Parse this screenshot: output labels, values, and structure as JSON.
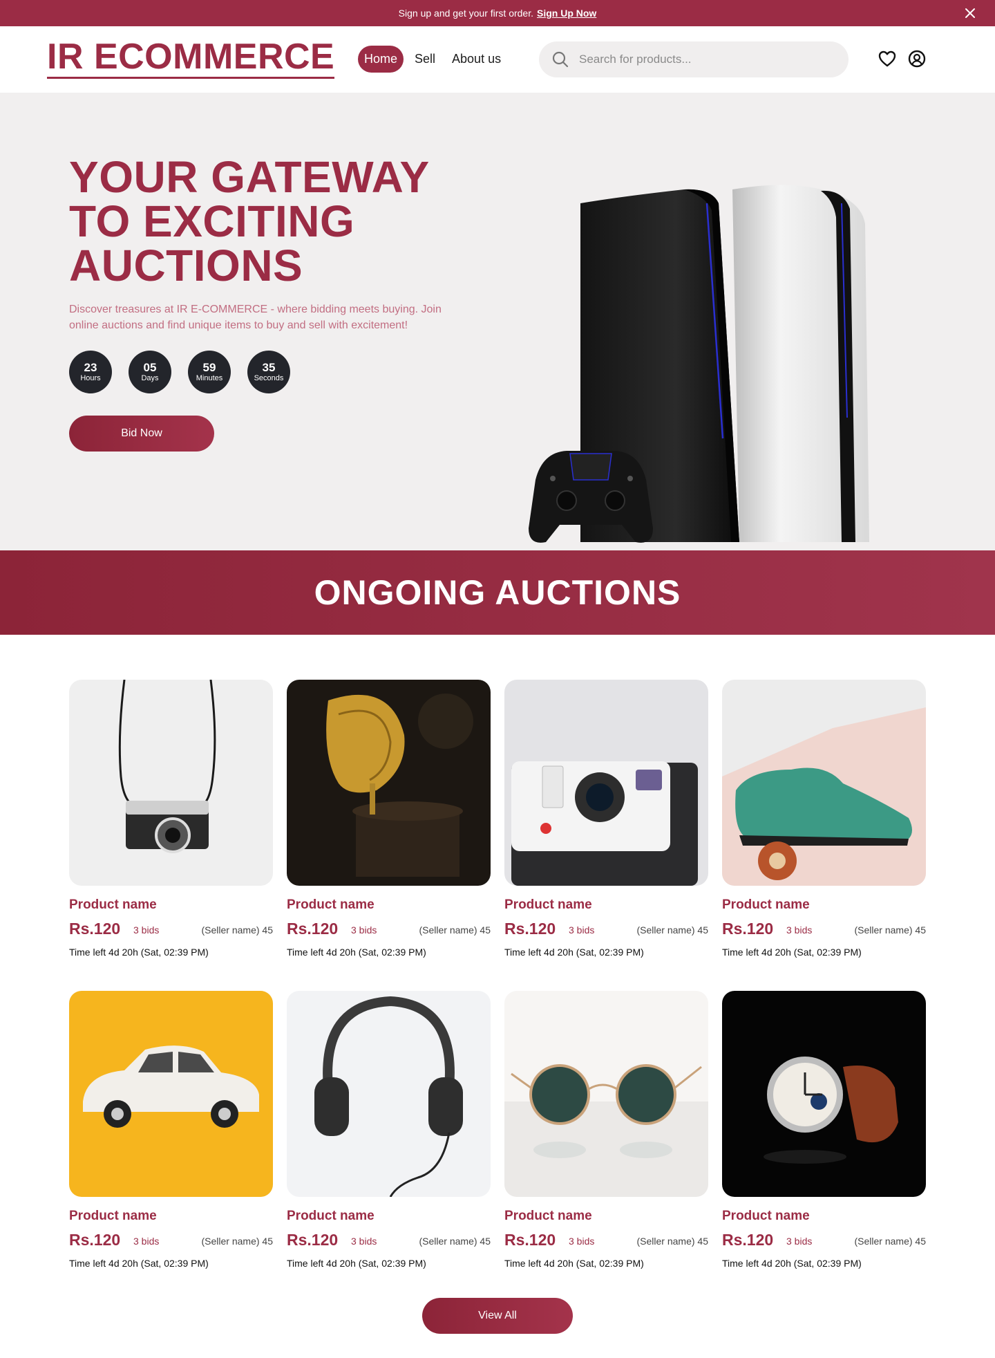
{
  "announcement": {
    "text": "Sign up and get your first order.",
    "cta": "Sign Up Now"
  },
  "header": {
    "logo": "IR ECOMMERCE",
    "nav": [
      {
        "label": "Home"
      },
      {
        "label": "Sell"
      },
      {
        "label": "About us"
      }
    ],
    "search_placeholder": "Search for products..."
  },
  "hero": {
    "title": "YOUR GATEWAY TO EXCITING AUCTIONS",
    "subtitle": "Discover treasures at IR E-COMMERCE - where bidding meets buying. Join online auctions and find unique items to buy and sell with excitement!",
    "countdown": [
      {
        "value": "23",
        "unit": "Hours"
      },
      {
        "value": "05",
        "unit": "Days"
      },
      {
        "value": "59",
        "unit": "Minutes"
      },
      {
        "value": "35",
        "unit": "Seconds"
      }
    ],
    "cta": "Bid Now"
  },
  "section_title": "ONGOING AUCTIONS",
  "products": [
    {
      "name": "Product name",
      "price": "Rs.120",
      "bids": "3 bids",
      "seller": "(Seller name)  45",
      "time": "Time left 4d 20h (Sat, 02:39 PM)",
      "image": "film-camera"
    },
    {
      "name": "Product name",
      "price": "Rs.120",
      "bids": "3 bids",
      "seller": "(Seller name)  45",
      "time": "Time left 4d 20h (Sat, 02:39 PM)",
      "image": "gramophone"
    },
    {
      "name": "Product name",
      "price": "Rs.120",
      "bids": "3 bids",
      "seller": "(Seller name)  45",
      "time": "Time left 4d 20h (Sat, 02:39 PM)",
      "image": "instant-camera"
    },
    {
      "name": "Product name",
      "price": "Rs.120",
      "bids": "3 bids",
      "seller": "(Seller name)  45",
      "time": "Time left 4d 20h (Sat, 02:39 PM)",
      "image": "green-shoe"
    },
    {
      "name": "Product name",
      "price": "Rs.120",
      "bids": "3 bids",
      "seller": "(Seller name)  45",
      "time": "Time left 4d 20h (Sat, 02:39 PM)",
      "image": "toy-car"
    },
    {
      "name": "Product name",
      "price": "Rs.120",
      "bids": "3 bids",
      "seller": "(Seller name)  45",
      "time": "Time left 4d 20h (Sat, 02:39 PM)",
      "image": "headphones"
    },
    {
      "name": "Product name",
      "price": "Rs.120",
      "bids": "3 bids",
      "seller": "(Seller name)  45",
      "time": "Time left 4d 20h (Sat, 02:39 PM)",
      "image": "sunglasses"
    },
    {
      "name": "Product name",
      "price": "Rs.120",
      "bids": "3 bids",
      "seller": "(Seller name)  45",
      "time": "Time left 4d 20h (Sat, 02:39 PM)",
      "image": "wristwatch"
    }
  ],
  "view_all": "View All",
  "colors": {
    "brand": "#9b2c45",
    "hero_bg": "#f1efef",
    "countdown_bg": "#23252b"
  }
}
